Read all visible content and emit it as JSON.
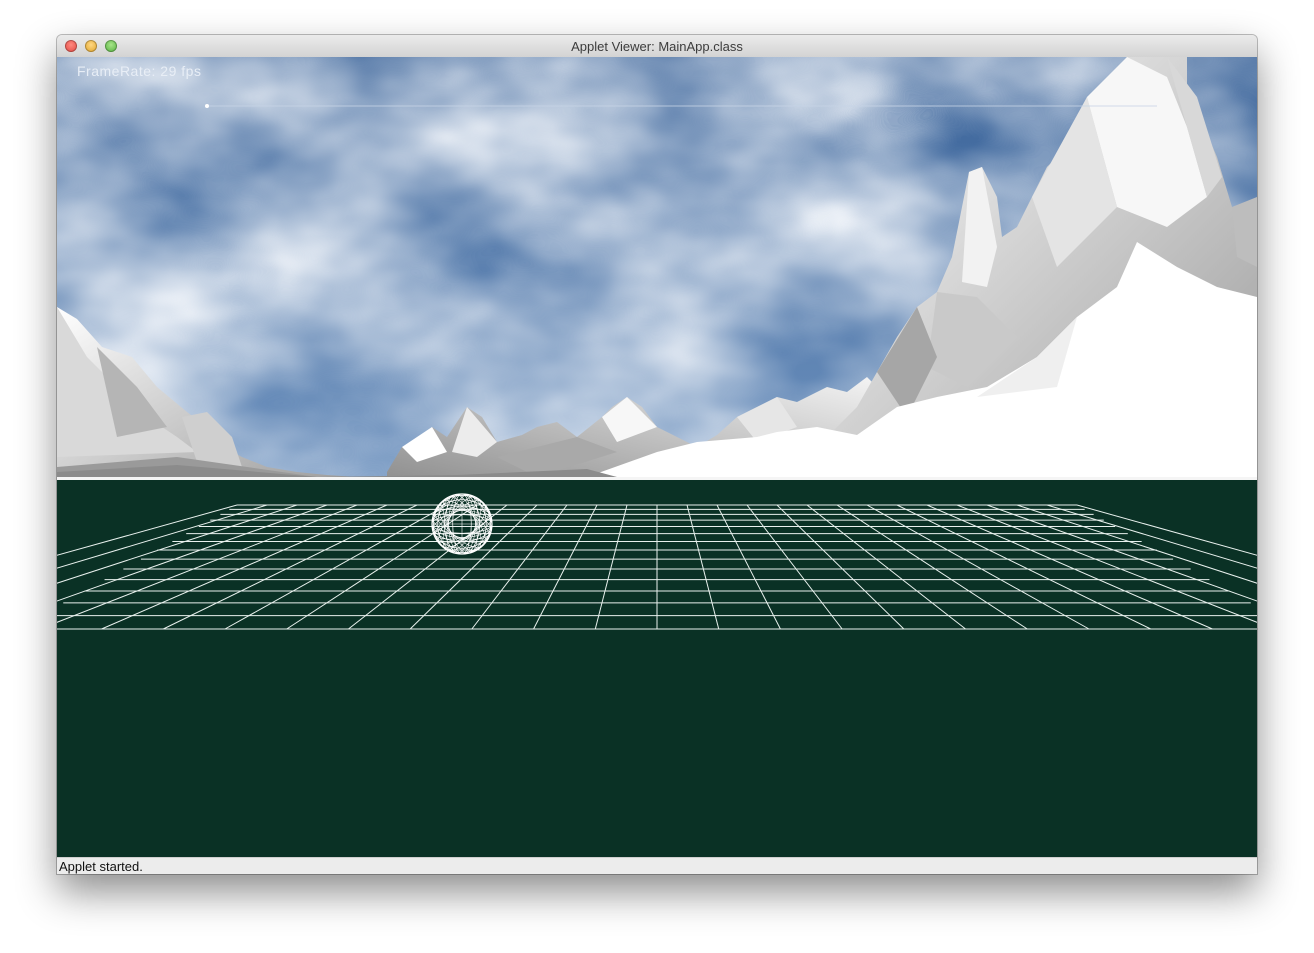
{
  "window": {
    "title": "Applet Viewer: MainApp.class"
  },
  "overlay": {
    "framerate_text": "FrameRate: 29 fps"
  },
  "status": {
    "text": "Applet started."
  },
  "colors": {
    "sky": "#3f6aa0",
    "ground": "#0a3125",
    "grid": "#ffffff",
    "mountains": "#e8e8e8"
  },
  "icons": [
    "close-icon",
    "minimize-icon",
    "maximize-icon"
  ]
}
